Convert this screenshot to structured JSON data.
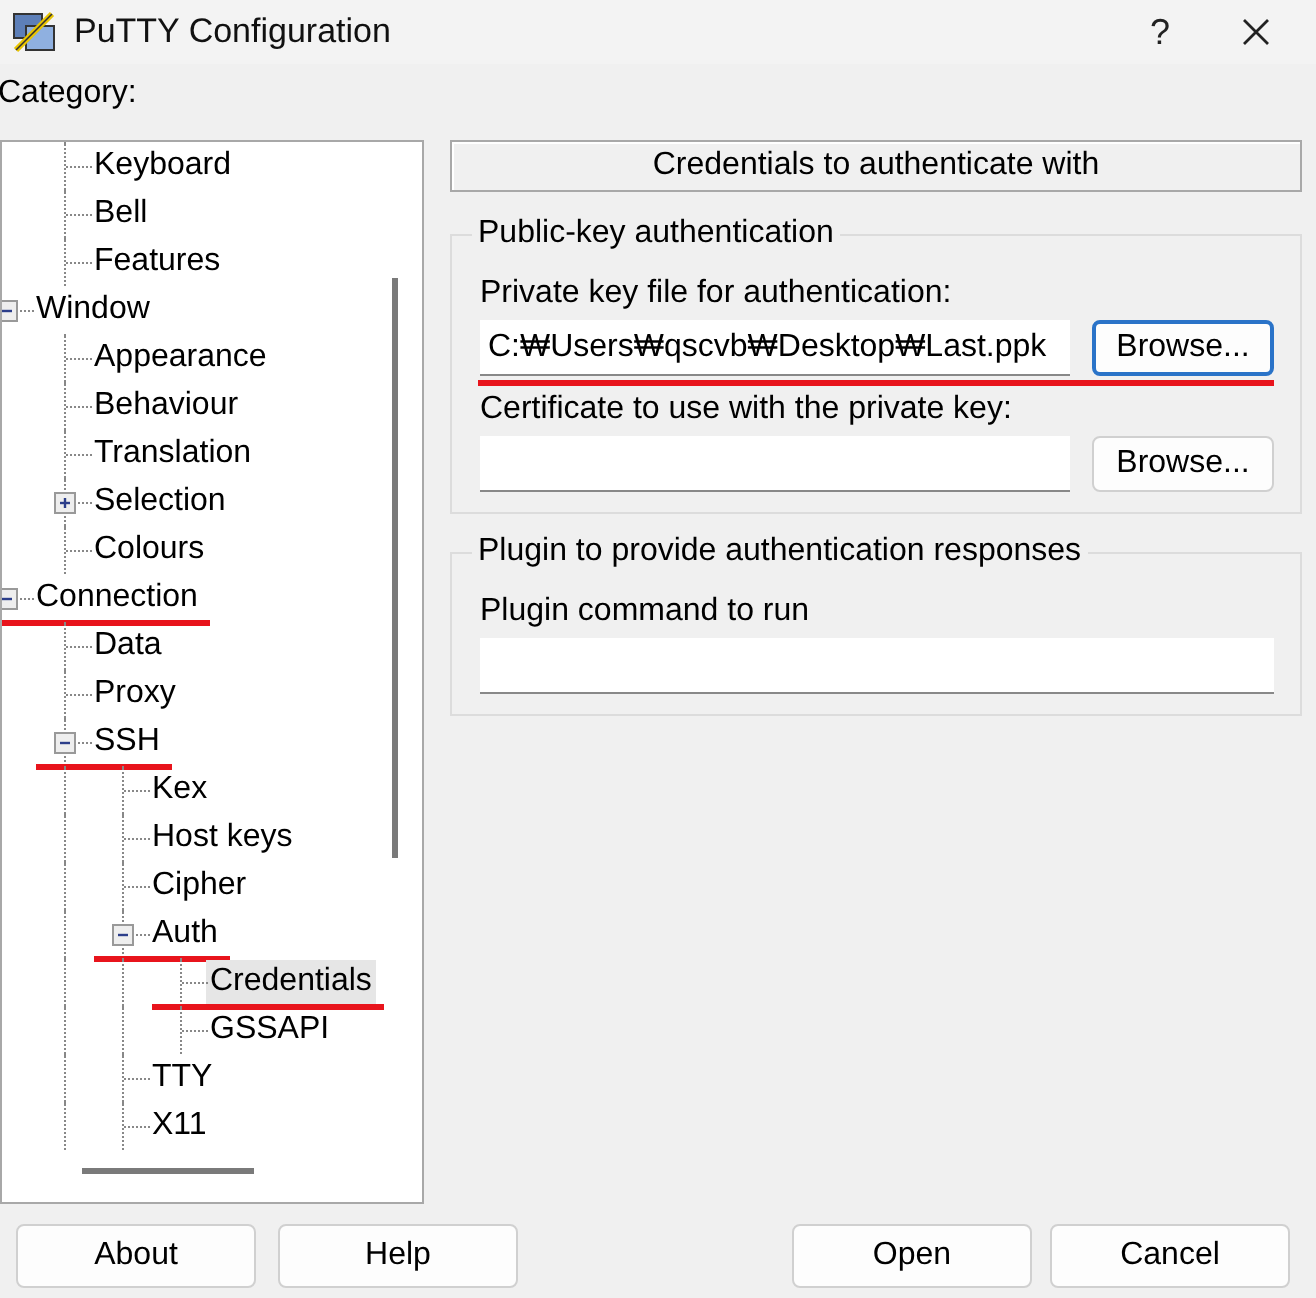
{
  "window": {
    "title": "PuTTY Configuration",
    "help": "?"
  },
  "category_label": "Category:",
  "tree": [
    {
      "children": [
        {
          "label": "Keyboard",
          "selected": false,
          "underlined": false
        },
        {
          "label": "Bell",
          "selected": false,
          "underlined": false
        },
        {
          "label": "Features",
          "selected": false,
          "underlined": false
        }
      ]
    },
    {
      "label": "Window",
      "expanded": true,
      "selected": false,
      "underlined": false,
      "children": [
        {
          "label": "Appearance",
          "selected": false,
          "underlined": false
        },
        {
          "label": "Behaviour",
          "selected": false,
          "underlined": false
        },
        {
          "label": "Translation",
          "selected": false,
          "underlined": false
        },
        {
          "label": "Selection",
          "expanded": false,
          "selected": false,
          "underlined": false
        },
        {
          "label": "Colours",
          "selected": false,
          "underlined": false
        }
      ]
    },
    {
      "label": "Connection",
      "expanded": true,
      "selected": false,
      "underlined": true,
      "children": [
        {
          "label": "Data",
          "selected": false,
          "underlined": false
        },
        {
          "label": "Proxy",
          "selected": false,
          "underlined": false
        },
        {
          "label": "SSH",
          "expanded": true,
          "selected": false,
          "underlined": true,
          "children": [
            {
              "label": "Kex",
              "selected": false,
              "underlined": false
            },
            {
              "label": "Host keys",
              "selected": false,
              "underlined": false
            },
            {
              "label": "Cipher",
              "selected": false,
              "underlined": false
            },
            {
              "label": "Auth",
              "expanded": true,
              "selected": false,
              "underlined": true,
              "children": [
                {
                  "label": "Credentials",
                  "selected": true,
                  "underlined": true
                },
                {
                  "label": "GSSAPI",
                  "selected": false,
                  "underlined": false
                }
              ]
            },
            {
              "label": "TTY",
              "selected": false,
              "underlined": false
            },
            {
              "label": "X11",
              "selected": false,
              "underlined": false
            }
          ]
        }
      ]
    }
  ],
  "panel_title": "Credentials to authenticate with",
  "groups": [
    {
      "title": "Public-key authentication",
      "fields": [
        {
          "label": "Private key file for authentication:",
          "value": "C:₩Users₩qscvb₩Desktop₩Last.ppk",
          "button": "Browse...",
          "focused": true,
          "underlined": true
        },
        {
          "label": "Certificate to use with the private key:",
          "button": "Browse...",
          "focused": false,
          "underlined": false
        }
      ]
    },
    {
      "title": "Plugin to provide authentication responses",
      "fields": [
        {
          "label": "Plugin command to run",
          "underlined": false
        }
      ]
    }
  ],
  "buttons_left": [
    "About",
    "Help"
  ],
  "buttons_right": [
    "Open",
    "Cancel"
  ]
}
